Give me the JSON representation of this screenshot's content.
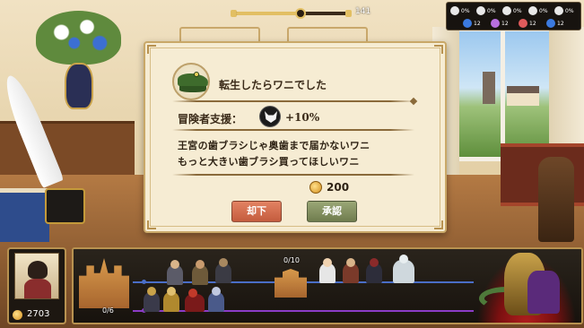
{
  "progress": {
    "fraction": 0.58,
    "label": "141"
  },
  "stats": [
    {
      "icon": "skull-icon",
      "value": "0%",
      "color": "#e8e8e8"
    },
    {
      "icon": "ghost-icon",
      "value": "0%",
      "color": "#e8e8e8"
    },
    {
      "icon": "feather-icon",
      "value": "0%",
      "color": "#e8e8e8"
    },
    {
      "icon": "bird-icon",
      "value": "0%",
      "color": "#e8e8e8"
    },
    {
      "icon": "wolf-icon",
      "value": "0%",
      "color": "#e8e8e8"
    },
    {
      "icon": "cross-icon",
      "value": "12",
      "color": "#3b7ae0"
    },
    {
      "icon": "sword-icon",
      "value": "12",
      "color": "#b86fe0"
    },
    {
      "icon": "axe-icon",
      "value": "12",
      "color": "#e05b5b"
    },
    {
      "icon": "shield-icon",
      "value": "12",
      "color": "#3b7ae0"
    }
  ],
  "dialog": {
    "portrait_icon": "crocodile-icon",
    "title": "転生したらワニでした",
    "support_label": "冒険者支援：",
    "support_icon": "wolf-icon",
    "support_value": "+10%",
    "lines": [
      "王宮の歯ブラシじゃ奥歯まで届かないワニ",
      "もっと大きい歯ブラシ買ってほしいワニ"
    ],
    "reward_value": "200",
    "reject_label": "却下",
    "approve_label": "承認"
  },
  "player": {
    "gold": "2703"
  },
  "battle": {
    "left_count": "0/6",
    "mid_count": "0/10"
  },
  "colors": {
    "accent_gold": "#e2bf63",
    "reject": "#c45c3e",
    "approve": "#6f7c4e",
    "lane_ally": "#4a6ec7",
    "lane_enemy": "#8b3cc7"
  }
}
